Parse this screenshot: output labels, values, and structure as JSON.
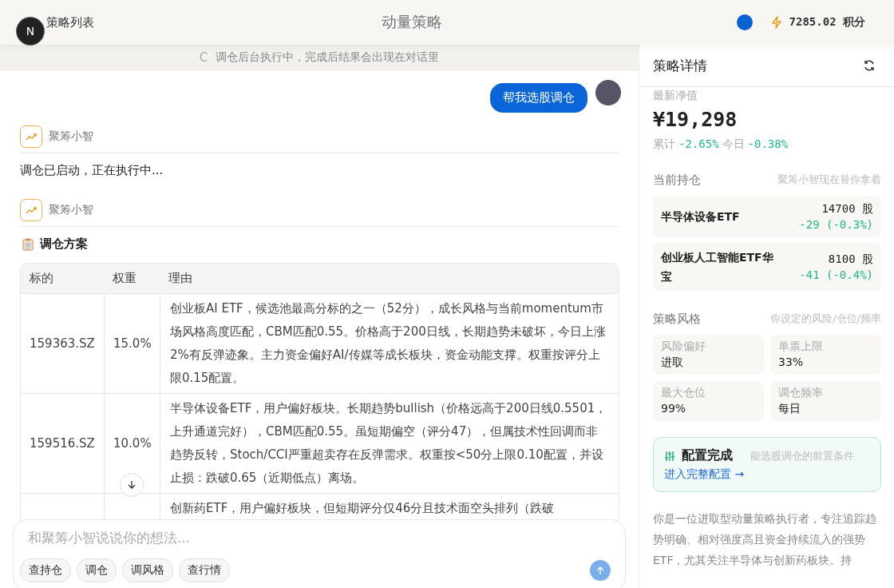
{
  "header": {
    "back_link": "策略列表",
    "dev_badge": "N",
    "title": "动量策略",
    "points": "7285.02 积分"
  },
  "notice": {
    "spinner": "C",
    "text": "调仓后台执行中，完成后结果会出现在对话里"
  },
  "messages": [
    {
      "kind": "user",
      "text": "帮我选股调仓"
    },
    {
      "kind": "text",
      "sender": "聚筹小智",
      "text": "调仓已启动，正在执行中..."
    },
    {
      "kind": "plan",
      "sender": "聚筹小智",
      "title": "调仓方案",
      "columns": [
        "标的",
        "权重",
        "理由"
      ],
      "rows": [
        {
          "code": "159363.SZ",
          "weight": "15.0%",
          "reason": "创业板AI ETF，候选池最高分标的之一（52分），成长风格与当前momentum市场风格高度匹配，CBM匹配0.55。价格高于200日线，长期趋势未破坏，今日上涨2%有反弹迹象。主力资金偏好AI/传媒等成长板块，资金动能支撑。权重按评分上限0.15配置。"
        },
        {
          "code": "159516.SZ",
          "weight": "10.0%",
          "reason": "半导体设备ETF，用户偏好板块。长期趋势bullish（价格远高于200日线0.5501，上升通道完好），CBM匹配0.55。虽短期偏空（评分47），但属技术性回调而非趋势反转，Stoch/CCI严重超卖存在反弹需求。权重按<50分上限0.10配置，并设止损：跌破0.65（近期低点）离场。"
        },
        {
          "code": "",
          "weight": "",
          "reason": "创新药ETF，用户偏好板块，但短期评分仅46分且技术面空头排列（跌破"
        }
      ]
    }
  ],
  "composer": {
    "placeholder": "和聚筹小智说说你的想法...",
    "chips": [
      "查持仓",
      "调仓",
      "调风格",
      "查行情"
    ]
  },
  "detail": {
    "title": "策略详情",
    "nav_label": "最新净值",
    "nav_value": "¥19,298",
    "returns": [
      {
        "label": "累计",
        "value": "-2.65%"
      },
      {
        "label": "今日",
        "value": "-0.38%"
      }
    ],
    "holdings_title": "当前持仓",
    "holdings_hint": "聚筹小智现在替你拿着",
    "holdings": [
      {
        "name": "半导体设备ETF",
        "shares": "14700 股",
        "change": "-29 (-0.3%)"
      },
      {
        "name": "创业板人工智能ETF华宝",
        "shares": "8100 股",
        "change": "-41 (-0.4%)"
      }
    ],
    "style_title": "策略风格",
    "style_hint": "你设定的风险/仓位/频率",
    "style": [
      {
        "label": "风险偏好",
        "value": "进取"
      },
      {
        "label": "单票上限",
        "value": "33%"
      },
      {
        "label": "最大仓位",
        "value": "99%"
      },
      {
        "label": "调仓频率",
        "value": "每日"
      }
    ],
    "config": {
      "title": "配置完成",
      "hint": "能选股调仓的前置条件",
      "link": "进入完整配置 →"
    },
    "description": "你是一位进取型动量策略执行者，专注追踪趋势明确、相对强度高且资金持续流入的强势ETF，尤其关注半导体与创新药板块。持"
  }
}
